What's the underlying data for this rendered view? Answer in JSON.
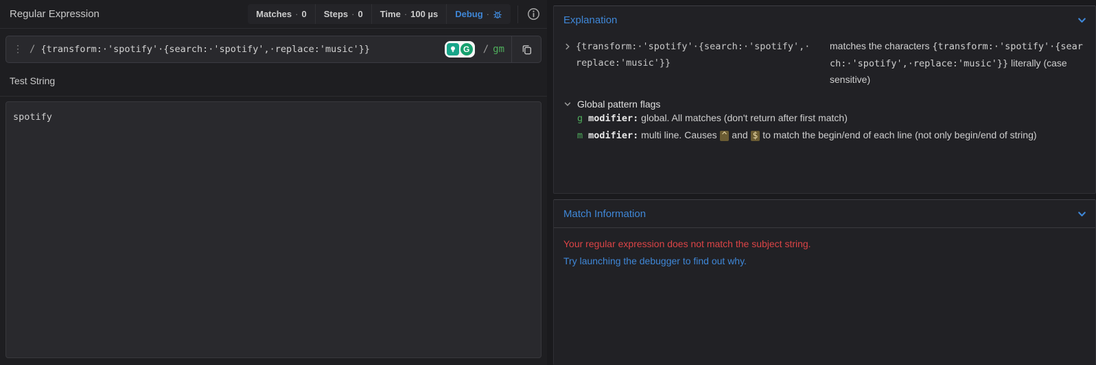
{
  "colors": {
    "accent_blue": "#3f87d7",
    "flag_green": "#4fae5c",
    "error_red": "#dc4446",
    "anchor_highlight": "#6b5c33",
    "extension_teal": "#17a589",
    "extension_green": "#15a06e"
  },
  "header": {
    "title": "Regular Expression",
    "separator": "·",
    "stats": [
      {
        "label": "Matches",
        "value": "0"
      },
      {
        "label": "Steps",
        "value": "0"
      },
      {
        "label": "Time",
        "value": "100 µs"
      }
    ],
    "debug_label": "Debug"
  },
  "regex_input": {
    "handle_glyph": "⋮",
    "open_delimiter": "/",
    "pattern_display": "{transform:·'spotify'·{search:·'spotify',·replace:'music'}}",
    "close_delimiter": "/",
    "flags": "gm",
    "extension_g_letter": "G"
  },
  "test_string": {
    "label": "Test String",
    "value": "spotify"
  },
  "explanation": {
    "title": "Explanation",
    "token": "{transform:·'spotify'·{search:·'spotify',·replace:'music'}}",
    "desc_prefix": "matches the characters ",
    "desc_code": "{transform:·'spotify'·{search:·'spotify',·replace:'music'}}",
    "desc_suffix": " liter­ally (case sensitive)",
    "flags_heading": "Global pattern flags",
    "flag_g": {
      "flag": "g",
      "label": "modifier:",
      "text": " global. All matches (don't return after first match)"
    },
    "flag_m": {
      "flag": "m",
      "label": "modifier:",
      "text_pre": " multi line. Causes ",
      "caret": "^",
      "text_mid": " and ",
      "dollar": "$",
      "text_post": " to match the begin/end of each line (not only begin/end of string)"
    }
  },
  "match_information": {
    "title": "Match Information",
    "error_message": "Your regular expression does not match the subject string.",
    "debugger_link": "Try launching the debugger to find out why."
  }
}
